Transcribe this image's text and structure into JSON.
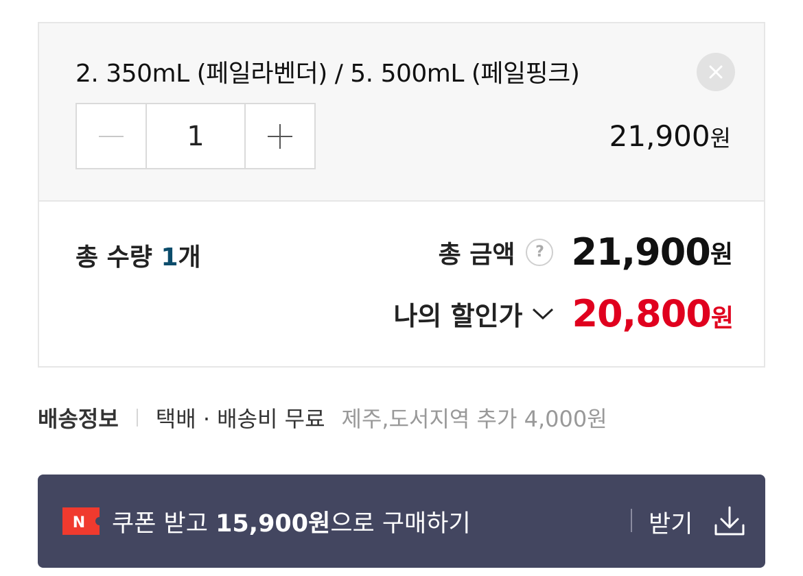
{
  "option": {
    "name": "2. 350mL (페일라벤더) / 5. 500mL (페일핑크)",
    "quantity": "1",
    "price": "21,900",
    "price_unit": "원"
  },
  "summary": {
    "quantity_label": "총 수량",
    "quantity_value": "1",
    "quantity_unit": "개",
    "total_label": "총 금액",
    "help_icon_glyph": "?",
    "total_price": "21,900",
    "total_unit": "원",
    "discount_label": "나의 할인가",
    "discount_price": "20,800",
    "discount_unit": "원"
  },
  "shipping": {
    "title": "배송정보",
    "method": "택배 · 배송비 무료",
    "extra": "제주,도서지역 추가 4,000원"
  },
  "coupon": {
    "badge": "N",
    "text_prefix": "쿠폰 받고 ",
    "amount": "15,900원",
    "text_suffix": "으로 구매하기",
    "receive_label": "받기"
  },
  "colors": {
    "discount_red": "#e0001e",
    "coupon_bg": "#434660",
    "badge_red": "#f03a2e",
    "count_blue": "#0b4c6b"
  },
  "icons": [
    "close-icon",
    "minus-icon",
    "plus-icon",
    "help-icon",
    "chevron-down-icon",
    "naver-n-icon",
    "download-icon"
  ]
}
